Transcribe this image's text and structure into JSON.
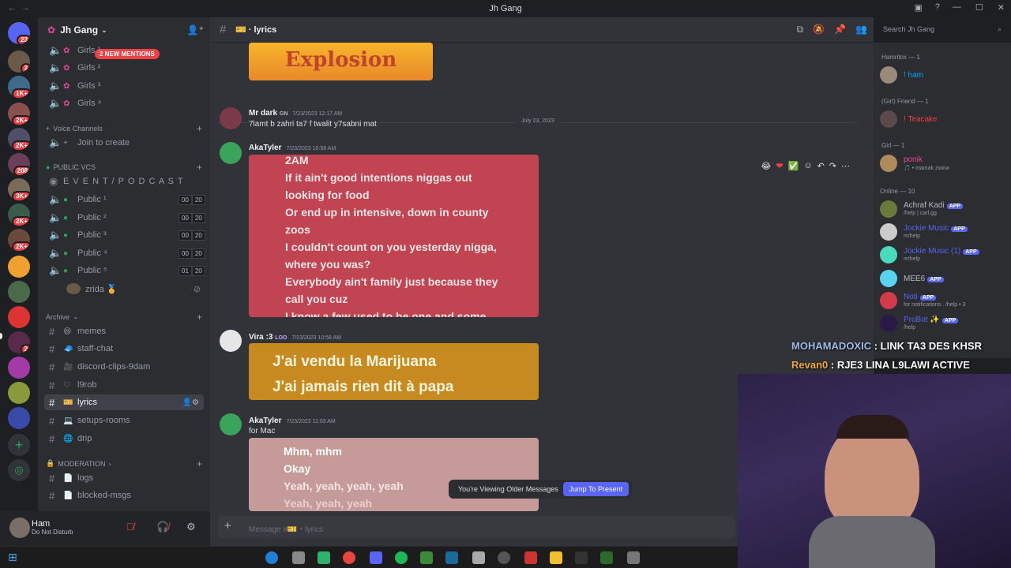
{
  "window": {
    "title": "Jh Gang"
  },
  "servers": {
    "badges": [
      "23",
      "3",
      "1K+",
      "2K+",
      "2K+",
      "208",
      "3K+",
      "2K+",
      "2K+",
      "2",
      "2"
    ]
  },
  "sidebar": {
    "guild_name": "Jh Gang",
    "mentions_badge": "2 NEW MENTIONS",
    "channels_top": [
      "Girls ¹",
      "Girls ²",
      "Girls ³",
      "Girls ⁴"
    ],
    "voice_category": "Voice Channels",
    "join_to_create": "Join to create",
    "public_category": "PUBLIC VCs",
    "event_channel": "E V E N T / P O D C A S T",
    "publics": [
      {
        "name": "Public ¹",
        "a": "00",
        "b": "20"
      },
      {
        "name": "Public ²",
        "a": "00",
        "b": "20"
      },
      {
        "name": "Public ³",
        "a": "00",
        "b": "20"
      },
      {
        "name": "Public ⁴",
        "a": "00",
        "b": "20"
      },
      {
        "name": "Public ⁵",
        "a": "01",
        "b": "20"
      }
    ],
    "voice_user": "zrida 🏅",
    "archive_category": "Archive",
    "archive": [
      "memes",
      "staff-chat",
      "discord-clips-9dam",
      "l9rob",
      "lyrics",
      "setups-rooms",
      "drip"
    ],
    "moderation_category": "MODERATION",
    "moderation": [
      "logs",
      "blocked-msgs"
    ]
  },
  "user": {
    "name": "Ham",
    "status": "Do Not Disturb"
  },
  "chat": {
    "channel_name": "lyrics",
    "search_placeholder": "Search Jh Gang",
    "top_image_text": "Explosion",
    "date_divider": "July 23, 2023",
    "messages": [
      {
        "author": "Mr dark",
        "tag": "GN",
        "time": "7/23/2023 12:17 AM",
        "text": "7lamt b zahri ta7 f twalit y7sabni mat"
      },
      {
        "author": "AkaTyler",
        "time": "7/23/2023 10:56 AM",
        "lyrics": [
          "2AM",
          "If it ain't good intentions niggas out",
          "looking for food",
          "Or end up in intensive, down in county",
          "zoos",
          "I couldn't count on you yesterday nigga,",
          "where you was?",
          "Everybody ain't family just because they",
          "call you cuz",
          "I know a few used to be one and some"
        ]
      },
      {
        "author": "Vira :3",
        "tag": "LOO",
        "time": "7/23/2023 10:58 AM",
        "lyrics": [
          "J'ai vendu la Marijuana",
          "J'ai jamais rien dit à papa"
        ]
      },
      {
        "author": "AkaTyler",
        "time": "7/23/2023 11:03 AM",
        "text": "for Mac",
        "lyrics": [
          "Mhm, mhm",
          "Okay",
          "Yeah, yeah, yeah, yeah",
          "Yeah, yeah, yeah"
        ]
      }
    ],
    "older_text": "You're Viewing Older Messages",
    "jump_label": "Jump To Present",
    "composer_placeholder": "Message #🎫・lyrics"
  },
  "members": {
    "sections": [
      {
        "header": "Hamritox — 1",
        "members": [
          {
            "name": "! ham",
            "color": "#00a8fc"
          }
        ]
      },
      {
        "header": "(Girl) Friend — 1",
        "members": [
          {
            "name": "! Teacake",
            "color": "#f23f43"
          }
        ]
      },
      {
        "header": "Girl — 1",
        "members": [
          {
            "name": "ponik",
            "status": "mamak zwina",
            "color": "#eb459e"
          }
        ]
      },
      {
        "header": "Online — 10",
        "members": [
          {
            "name": "Achraf Kadi",
            "status": "/help | carl.gg",
            "app": "APP",
            "color": "#949ba4"
          },
          {
            "name": "Jockie Music",
            "status": "m!help",
            "app": "APP",
            "color": "#5865f2"
          },
          {
            "name": "Jockie Music (1)",
            "status": "m!help",
            "app": "APP",
            "color": "#5865f2"
          },
          {
            "name": "MEE6",
            "app": "APP",
            "color": "#949ba4"
          },
          {
            "name": "Noti",
            "status": "for notifications.. /help • 3",
            "app": "APP",
            "color": "#5865f2"
          },
          {
            "name": "ProBot ✨",
            "status": "/help",
            "app": "APP",
            "color": "#5865f2"
          }
        ]
      }
    ]
  },
  "stream_overlay": [
    {
      "user": "MOHAMADOXIC",
      "text": "LINK TA3 DES KHSR",
      "color": "#9fb8e6"
    },
    {
      "user": "Revan0",
      "text": "RJE3 LINA L9LAWI ACTIVE",
      "color": "#f0a93a"
    }
  ]
}
